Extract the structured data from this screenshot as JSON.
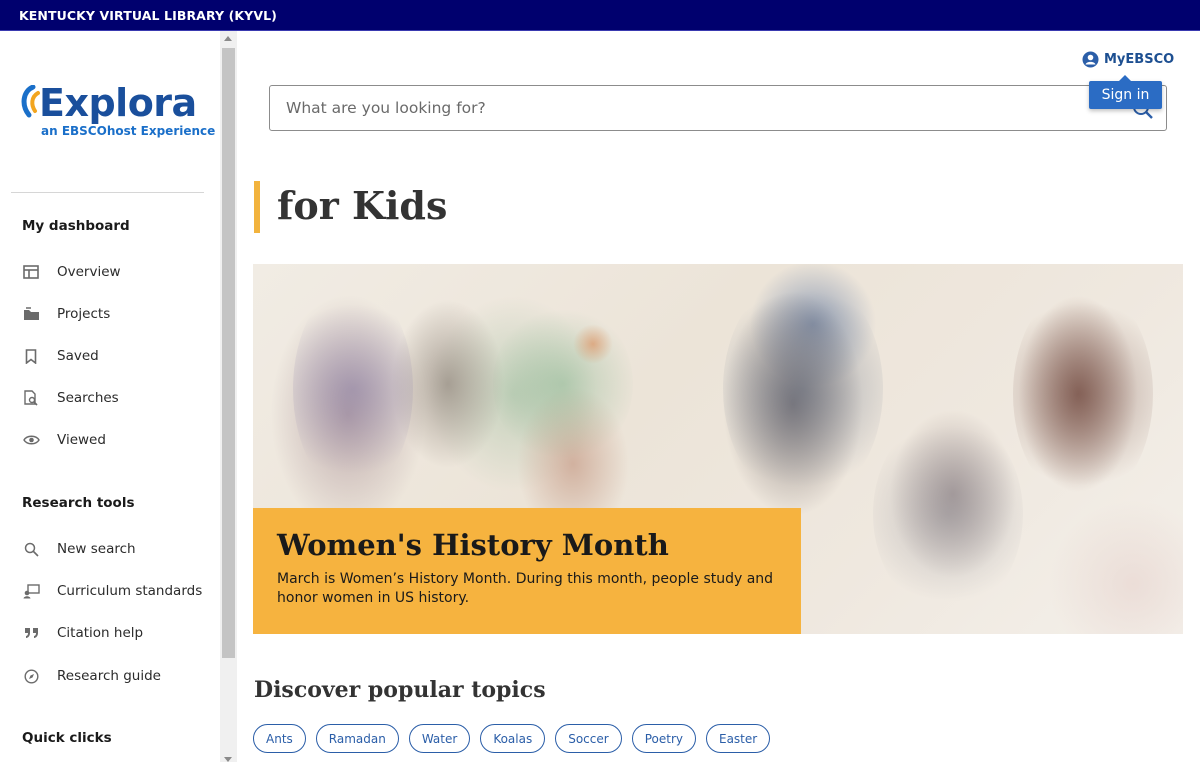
{
  "topbar": {
    "title": "KENTUCKY VIRTUAL LIBRARY (KYVL)"
  },
  "logo": {
    "name": "Explora",
    "subtitle": "an EBSCOhost Experience"
  },
  "sidebar": {
    "dashboard_title": "My dashboard",
    "dashboard_items": [
      {
        "label": "Overview",
        "icon": "overview-icon"
      },
      {
        "label": "Projects",
        "icon": "folder-icon"
      },
      {
        "label": "Saved",
        "icon": "bookmark-icon"
      },
      {
        "label": "Searches",
        "icon": "search-history-icon"
      },
      {
        "label": "Viewed",
        "icon": "eye-icon"
      }
    ],
    "tools_title": "Research tools",
    "tools_items": [
      {
        "label": "New search",
        "icon": "search-icon"
      },
      {
        "label": "Curriculum standards",
        "icon": "curriculum-icon"
      },
      {
        "label": "Citation help",
        "icon": "quote-icon"
      },
      {
        "label": "Research guide",
        "icon": "compass-icon"
      }
    ],
    "quick_title": "Quick clicks"
  },
  "header": {
    "myebsco_label": "MyEBSCO",
    "signin_label": "Sign in"
  },
  "search": {
    "placeholder": "What are you looking for?"
  },
  "page": {
    "title": "for Kids"
  },
  "hero": {
    "heading": "Women's History Month",
    "text": "March is Women’s History Month. During this month, people study and honor women in US history."
  },
  "discover": {
    "title": "Discover popular topics",
    "topics": [
      "Ants",
      "Ramadan",
      "Water",
      "Koalas",
      "Soccer",
      "Poetry",
      "Easter"
    ]
  },
  "colors": {
    "topbar": "#00006e",
    "accent": "#f6b33f",
    "brand_blue": "#1a4f9c",
    "link_blue": "#2b5ea8"
  }
}
